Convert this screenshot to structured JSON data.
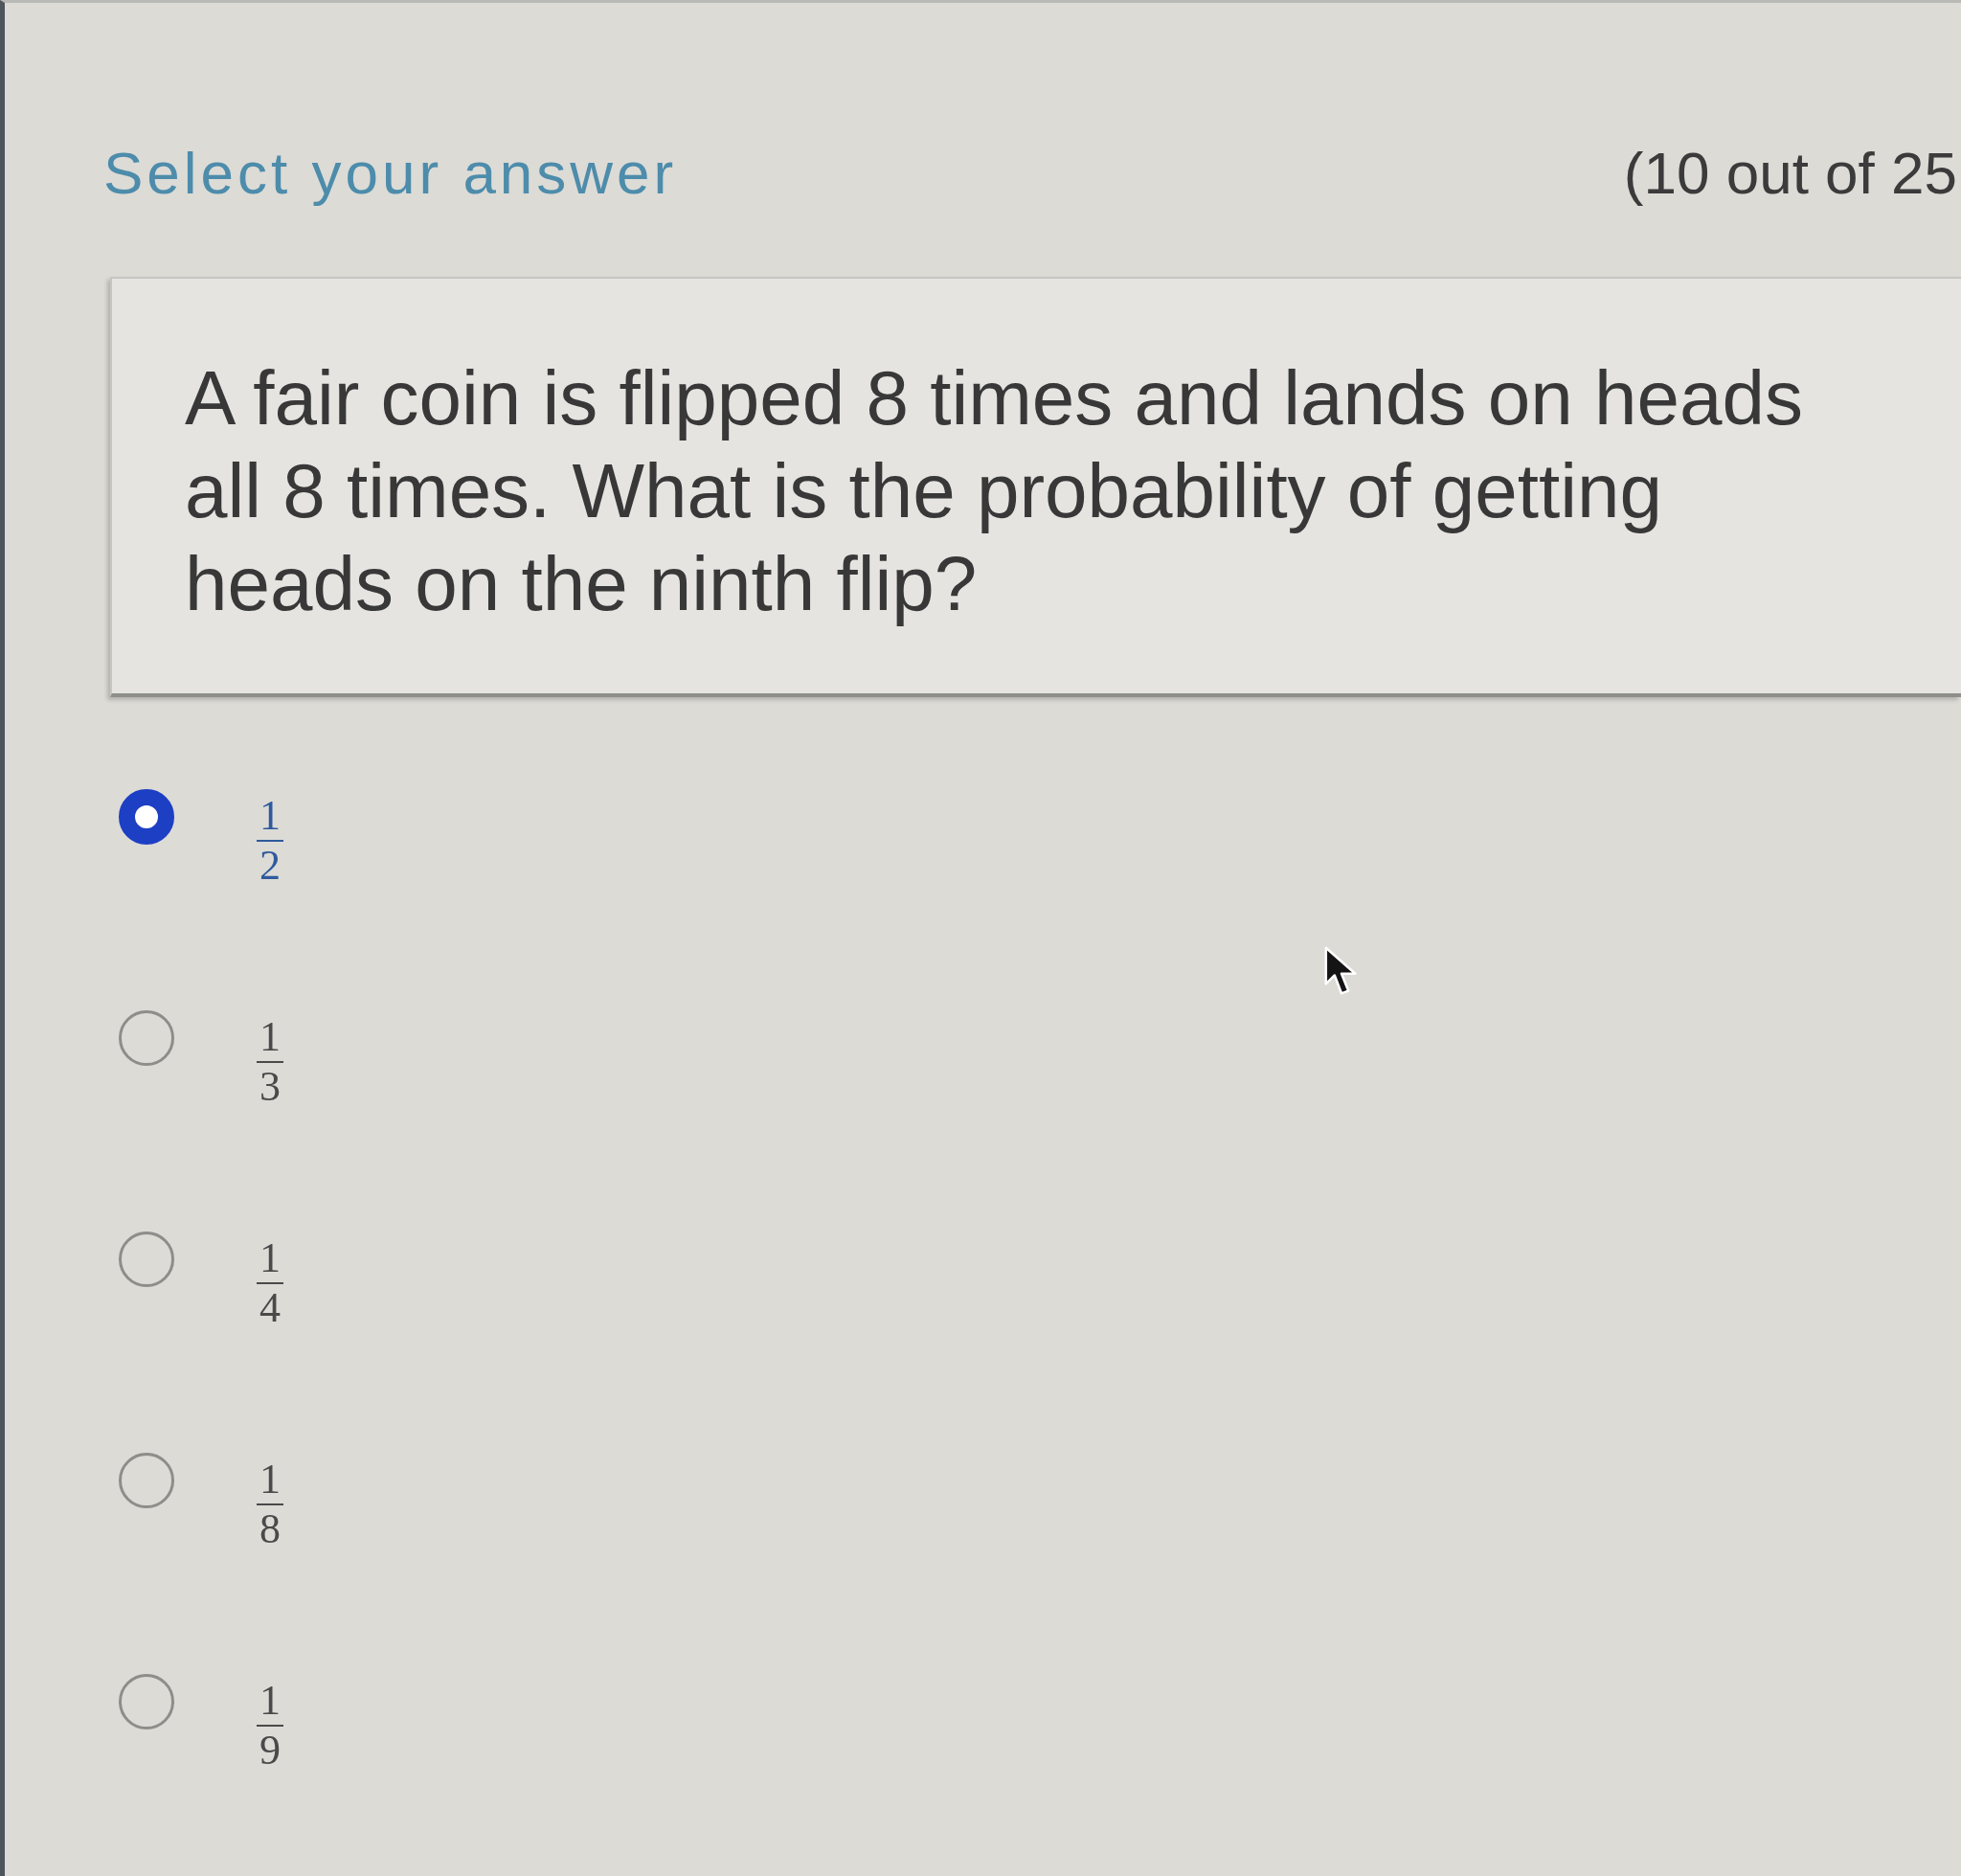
{
  "header": {
    "title": "Select your answer",
    "counter": "(10 out of 25"
  },
  "question": {
    "text": "A fair coin is flipped 8 times and lands on heads all 8 times. What is the probability of getting heads on the ninth flip?"
  },
  "options": [
    {
      "numerator": "1",
      "denominator": "2",
      "selected": true
    },
    {
      "numerator": "1",
      "denominator": "3",
      "selected": false
    },
    {
      "numerator": "1",
      "denominator": "4",
      "selected": false
    },
    {
      "numerator": "1",
      "denominator": "8",
      "selected": false
    },
    {
      "numerator": "1",
      "denominator": "9",
      "selected": false
    }
  ]
}
